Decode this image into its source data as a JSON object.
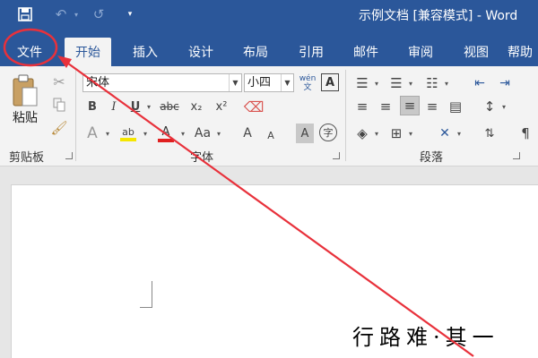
{
  "app": {
    "title": "示例文档 [兼容模式] - Word"
  },
  "quick_access": {
    "save_icon": "save-icon",
    "undo_icon": "undo-icon",
    "redo_icon": "redo-icon",
    "customize_icon": "customize-quick-access-icon"
  },
  "tabs": [
    {
      "label": "文件"
    },
    {
      "label": "开始"
    },
    {
      "label": "插入"
    },
    {
      "label": "设计"
    },
    {
      "label": "布局"
    },
    {
      "label": "引用"
    },
    {
      "label": "邮件"
    },
    {
      "label": "审阅"
    },
    {
      "label": "视图"
    },
    {
      "label": "帮助"
    }
  ],
  "ribbon": {
    "clipboard": {
      "label": "剪贴板",
      "paste_label": "粘贴"
    },
    "font": {
      "label": "字体",
      "font_name": "宋体",
      "font_size": "小四",
      "phonetic_label": "wén\n文",
      "border_char": "A",
      "bold": "B",
      "italic": "I",
      "underline": "U",
      "strike": "abc",
      "subscript": "x₂",
      "superscript": "x²",
      "text_effect": "A",
      "highlight": "ab",
      "font_color": "A",
      "change_case": "Aa",
      "grow_font": "A",
      "shrink_font": "A",
      "char_shading": "A",
      "enclose_char": "字"
    },
    "paragraph": {
      "label": "段落"
    }
  },
  "document": {
    "text": "行路难·其一"
  },
  "colors": {
    "accent": "#2b579a",
    "annotation": "#e8313b",
    "highlight": "#f5e600",
    "font_color_bar": "#e02020"
  }
}
